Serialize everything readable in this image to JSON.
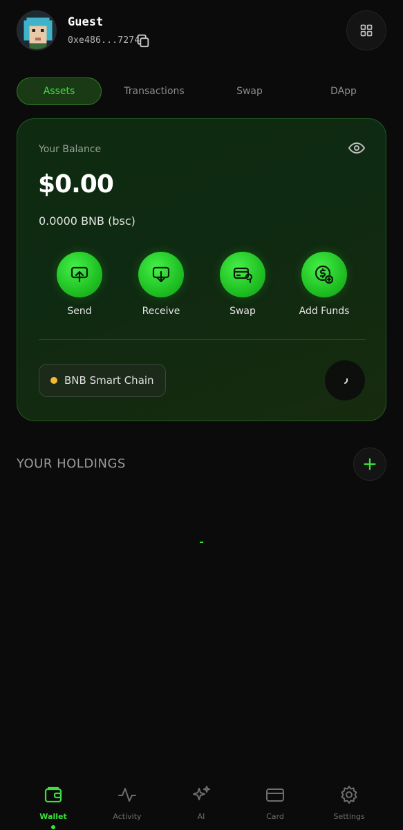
{
  "header": {
    "user_name": "Guest",
    "address": "0xe486...7274",
    "avatar_icon": "pixel-avatar-icon",
    "copy_icon": "copy-icon",
    "menu_icon": "grid-icon"
  },
  "tabs": [
    {
      "label": "Assets",
      "active": true
    },
    {
      "label": "Transactions",
      "active": false
    },
    {
      "label": "Swap",
      "active": false
    },
    {
      "label": "DApp",
      "active": false
    }
  ],
  "balance": {
    "label": "Your Balance",
    "value": "$0.00",
    "native": "0.0000 BNB (bsc)",
    "visibility_icon": "eye-icon"
  },
  "actions": [
    {
      "label": "Send",
      "icon": "send-icon"
    },
    {
      "label": "Receive",
      "icon": "receive-icon"
    },
    {
      "label": "Swap",
      "icon": "swap-icon"
    },
    {
      "label": "Add Funds",
      "icon": "add-funds-icon"
    }
  ],
  "network": {
    "name": "BNB Smart Chain",
    "dot_color": "#f3ba2f"
  },
  "holdings": {
    "title": "YOUR HOLDINGS",
    "add_icon": "plus-icon"
  },
  "bottom_nav": [
    {
      "label": "Wallet",
      "icon": "wallet-icon",
      "active": true
    },
    {
      "label": "Activity",
      "icon": "activity-icon",
      "active": false
    },
    {
      "label": "AI",
      "icon": "sparkle-icon",
      "active": false
    },
    {
      "label": "Card",
      "icon": "card-icon",
      "active": false
    },
    {
      "label": "Settings",
      "icon": "gear-icon",
      "active": false
    }
  ],
  "colors": {
    "accent": "#39e23a",
    "background": "#0b0b0b",
    "card_bg": "#0f2a12"
  }
}
